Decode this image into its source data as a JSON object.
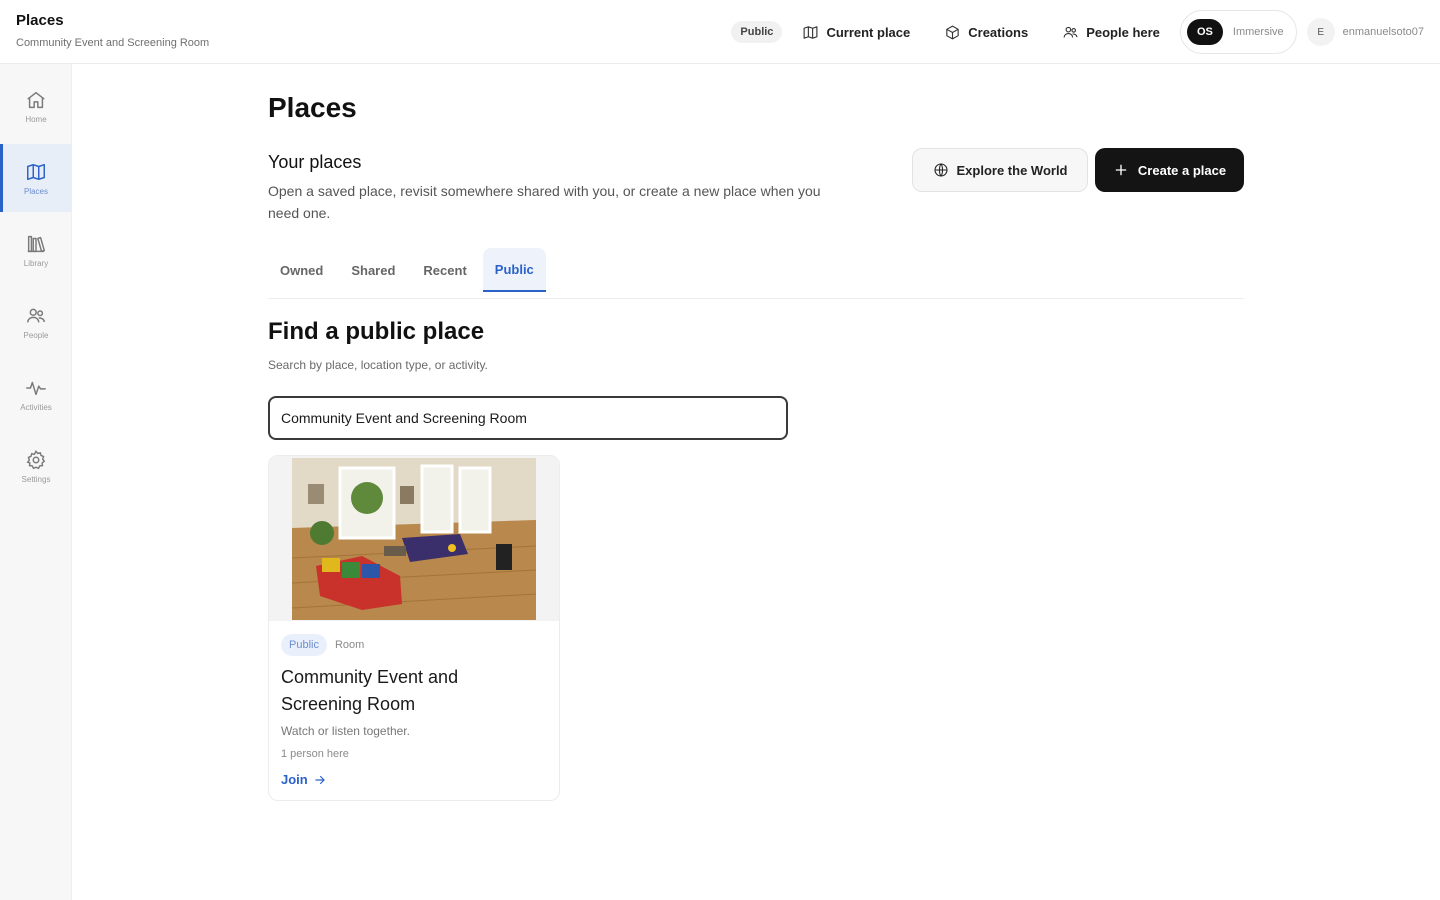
{
  "header": {
    "title": "Places",
    "subtitle": "Community Event and Screening Room",
    "visibility_badge": "Public",
    "links": [
      {
        "label": "Current place",
        "icon": "map-icon"
      },
      {
        "label": "Creations",
        "icon": "cube-icon"
      },
      {
        "label": "People here",
        "icon": "people-icon"
      }
    ],
    "mode": {
      "badge": "OS",
      "label": "Immersive"
    },
    "user": {
      "initial": "E",
      "name": "enmanuelsoto07"
    }
  },
  "sidebar": {
    "items": [
      {
        "label": "Home",
        "icon": "home-icon",
        "active": false
      },
      {
        "label": "Places",
        "icon": "map-icon",
        "active": true
      },
      {
        "label": "Library",
        "icon": "library-icon",
        "active": false
      },
      {
        "label": "People",
        "icon": "people-icon",
        "active": false
      },
      {
        "label": "Activities",
        "icon": "activity-icon",
        "active": false
      },
      {
        "label": "Settings",
        "icon": "gear-icon",
        "active": false
      }
    ]
  },
  "main": {
    "title": "Places",
    "section_title": "Your places",
    "section_desc": "Open a saved place, revisit somewhere shared with you, or create a new place when you need one.",
    "explore_button": "Explore the World",
    "create_button": "Create a place",
    "tabs": [
      {
        "label": "Owned",
        "active": false
      },
      {
        "label": "Shared",
        "active": false
      },
      {
        "label": "Recent",
        "active": false
      },
      {
        "label": "Public",
        "active": true
      }
    ],
    "find_title": "Find a public place",
    "find_desc": "Search by place, location type, or activity.",
    "search": {
      "value": "Community Event and Screening Room",
      "placeholder": ""
    },
    "results": [
      {
        "visibility": "Public",
        "type": "Room",
        "title": "Community Event and Screening Room",
        "description": "Watch or listen together.",
        "people_count": "1 person here",
        "action": "Join",
        "image": "room-thumbnail"
      }
    ]
  },
  "colors": {
    "accent": "#2b62c9",
    "primary_button": "#141414",
    "sidebar_bg": "#f7f7f7",
    "active_nav_bg": "#e8eef8"
  }
}
